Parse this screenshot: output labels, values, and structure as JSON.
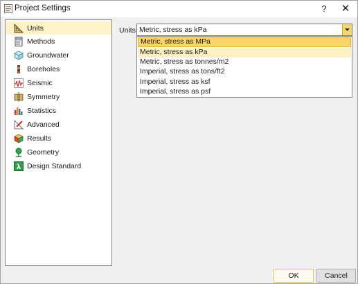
{
  "window": {
    "title": "Project Settings",
    "help_label": "?",
    "close_label": "✕"
  },
  "sidebar": {
    "items": [
      {
        "label": "Units",
        "icon": "ruler-triangle-icon",
        "selected": true
      },
      {
        "label": "Methods",
        "icon": "calculator-icon"
      },
      {
        "label": "Groundwater",
        "icon": "water-cube-icon"
      },
      {
        "label": "Boreholes",
        "icon": "borehole-icon"
      },
      {
        "label": "Seismic",
        "icon": "seismic-wave-icon"
      },
      {
        "label": "Symmetry",
        "icon": "symmetry-icon"
      },
      {
        "label": "Statistics",
        "icon": "histogram-icon"
      },
      {
        "label": "Advanced",
        "icon": "advanced-pencil-icon"
      },
      {
        "label": "Results",
        "icon": "results-cube-icon"
      },
      {
        "label": "Geometry",
        "icon": "geometry-icon"
      },
      {
        "label": "Design Standard",
        "icon": "lambda-icon"
      }
    ]
  },
  "units": {
    "label": "Units:",
    "selected_value": "Metric, stress as kPa",
    "options": [
      "Metric, stress as MPa",
      "Metric, stress as kPa",
      "Metric, stress as tonnes/m2",
      "Imperial, stress as tons/ft2",
      "Imperial, stress as ksf",
      "Imperial, stress as psf"
    ],
    "hovered_option_index": 0,
    "selected_option_index": 1
  },
  "buttons": {
    "ok": "OK",
    "cancel": "Cancel"
  },
  "colors": {
    "selection": "#fdf3c7",
    "hover": "#fcd56a",
    "accent": "#f5d66b"
  }
}
